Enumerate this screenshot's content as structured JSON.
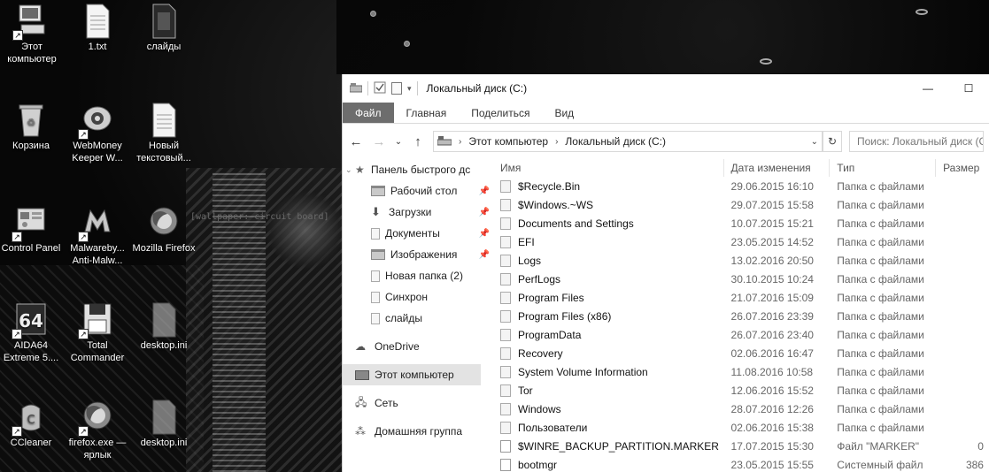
{
  "desktop": {
    "wallpaper_label": "[wallpaper: circuit board]",
    "icons": [
      {
        "label": "Этот компьютер",
        "icon": "computer-icon"
      },
      {
        "label": "1.txt",
        "icon": "text-file-icon"
      },
      {
        "label": "слайды",
        "icon": "document-icon"
      },
      {
        "label": "Корзина",
        "icon": "recycle-bin-icon"
      },
      {
        "label": "WebMoney Keeper W...",
        "icon": "webmoney-icon"
      },
      {
        "label": "Новый текстовый...",
        "icon": "text-file-icon"
      },
      {
        "label": "Control Panel",
        "icon": "control-panel-icon"
      },
      {
        "label": "Malwareby... Anti-Malw...",
        "icon": "malwarebytes-icon"
      },
      {
        "label": "Mozilla Firefox",
        "icon": "firefox-icon"
      },
      {
        "label": "AIDA64 Extreme 5....",
        "icon": "aida64-icon"
      },
      {
        "label": "Total Commander",
        "icon": "total-commander-icon"
      },
      {
        "label": "desktop.ini",
        "icon": "ini-file-icon"
      },
      {
        "label": "CCleaner",
        "icon": "ccleaner-icon"
      },
      {
        "label": "firefox.exe — ярлык",
        "icon": "firefox-icon"
      },
      {
        "label": "desktop.ini",
        "icon": "ini-file-icon"
      }
    ]
  },
  "explorer": {
    "title": "Локальный диск (C:)",
    "window_buttons": {
      "minimize": "—",
      "maximize": "☐"
    },
    "ribbon_tabs": [
      "Файл",
      "Главная",
      "Поделиться",
      "Вид"
    ],
    "address": {
      "root": "Этот компьютер",
      "current": "Локальный диск (C:)"
    },
    "search_placeholder": "Поиск: Локальный диск (C:)",
    "nav": {
      "quick_access": "Панель быстрого дс",
      "pinned": [
        {
          "label": "Рабочий стол",
          "icon": "desktop-icon"
        },
        {
          "label": "Загрузки",
          "icon": "downloads-icon"
        },
        {
          "label": "Документы",
          "icon": "documents-icon"
        },
        {
          "label": "Изображения",
          "icon": "pictures-icon"
        }
      ],
      "folders": [
        "Новая папка (2)",
        "Синхрон",
        "слайды"
      ],
      "onedrive": "OneDrive",
      "this_pc": "Этот компьютер",
      "network": "Сеть",
      "homegroup": "Домашняя группа"
    },
    "columns": {
      "name": "Имя",
      "date": "Дата изменения",
      "type": "Тип",
      "size": "Размер"
    },
    "files": [
      {
        "name": "$Recycle.Bin",
        "date": "29.06.2015 16:10",
        "type": "Папка с файлами",
        "size": ""
      },
      {
        "name": "$Windows.~WS",
        "date": "29.07.2015 15:58",
        "type": "Папка с файлами",
        "size": ""
      },
      {
        "name": "Documents and Settings",
        "date": "10.07.2015 15:21",
        "type": "Папка с файлами",
        "size": ""
      },
      {
        "name": "EFI",
        "date": "23.05.2015 14:52",
        "type": "Папка с файлами",
        "size": ""
      },
      {
        "name": "Logs",
        "date": "13.02.2016 20:50",
        "type": "Папка с файлами",
        "size": ""
      },
      {
        "name": "PerfLogs",
        "date": "30.10.2015 10:24",
        "type": "Папка с файлами",
        "size": ""
      },
      {
        "name": "Program Files",
        "date": "21.07.2016 15:09",
        "type": "Папка с файлами",
        "size": ""
      },
      {
        "name": "Program Files (x86)",
        "date": "26.07.2016 23:39",
        "type": "Папка с файлами",
        "size": ""
      },
      {
        "name": "ProgramData",
        "date": "26.07.2016 23:40",
        "type": "Папка с файлами",
        "size": ""
      },
      {
        "name": "Recovery",
        "date": "02.06.2016 16:47",
        "type": "Папка с файлами",
        "size": ""
      },
      {
        "name": "System Volume Information",
        "date": "11.08.2016 10:58",
        "type": "Папка с файлами",
        "size": ""
      },
      {
        "name": "Tor",
        "date": "12.06.2016 15:52",
        "type": "Папка с файлами",
        "size": ""
      },
      {
        "name": "Windows",
        "date": "28.07.2016 12:26",
        "type": "Папка с файлами",
        "size": ""
      },
      {
        "name": "Пользователи",
        "date": "02.06.2016 15:38",
        "type": "Папка с файлами",
        "size": ""
      },
      {
        "name": "$WINRE_BACKUP_PARTITION.MARKER",
        "date": "17.07.2015 15:30",
        "type": "Файл \"MARKER\"",
        "size": "0"
      },
      {
        "name": "bootmgr",
        "date": "23.05.2015 15:55",
        "type": "Системный файл",
        "size": "386"
      }
    ]
  }
}
